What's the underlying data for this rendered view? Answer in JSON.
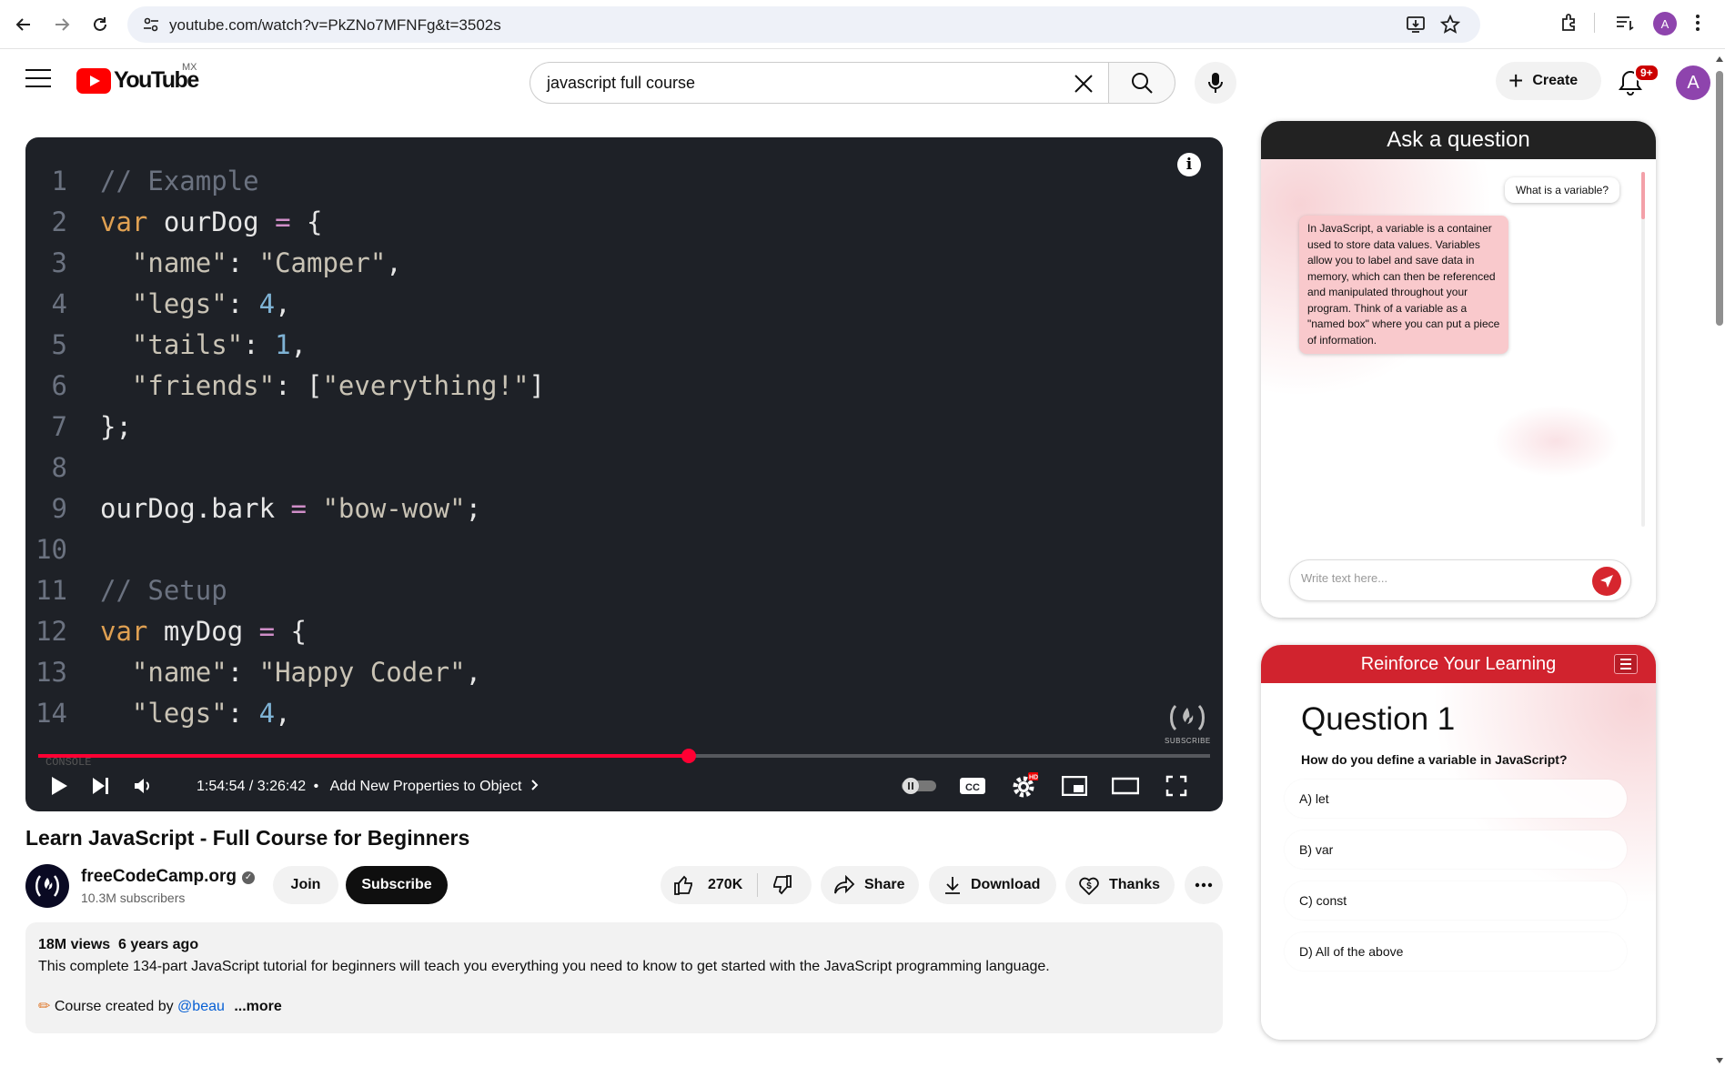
{
  "browser": {
    "url": "youtube.com/watch?v=PkZNo7MFNFg&t=3502s",
    "profile_initial": "A"
  },
  "header": {
    "logo_text": "YouTube",
    "region": "MX",
    "search_value": "javascript full course",
    "create_label": "Create",
    "notification_count": "9+",
    "avatar_initial": "A"
  },
  "player": {
    "code_lines": [
      {
        "n": "1",
        "text": "// Example"
      },
      {
        "n": "2",
        "text": "var ourDog = {"
      },
      {
        "n": "3",
        "text": "  \"name\": \"Camper\","
      },
      {
        "n": "4",
        "text": "  \"legs\": 4,"
      },
      {
        "n": "5",
        "text": "  \"tails\": 1,"
      },
      {
        "n": "6",
        "text": "  \"friends\": [\"everything!\"]"
      },
      {
        "n": "7",
        "text": "};"
      },
      {
        "n": "8",
        "text": ""
      },
      {
        "n": "9",
        "text": "ourDog.bark = \"bow-wow\";"
      },
      {
        "n": "10",
        "text": ""
      },
      {
        "n": "11",
        "text": "// Setup"
      },
      {
        "n": "12",
        "text": "var myDog = {"
      },
      {
        "n": "13",
        "text": "  \"name\": \"Happy Coder\","
      },
      {
        "n": "14",
        "text": "  \"legs\": 4,"
      }
    ],
    "console_label": "CONSOLE",
    "watermark_sub": "SUBSCRIBE",
    "current_time": "1:54:54",
    "duration": "3:26:42",
    "time_display": "1:54:54 / 3:26:42",
    "chapter_sep": "•",
    "chapter": "Add New Properties to Object",
    "progress_fraction": 0.555,
    "settings_badge": "HD"
  },
  "video": {
    "title": "Learn JavaScript - Full Course for Beginners",
    "channel": "freeCodeCamp.org",
    "subscribers": "10.3M subscribers",
    "join_label": "Join",
    "subscribe_label": "Subscribe",
    "likes": "270K",
    "share_label": "Share",
    "download_label": "Download",
    "thanks_label": "Thanks",
    "views": "18M views",
    "age": "6 years ago",
    "description": "This complete 134-part JavaScript tutorial for beginners will teach you everything you need to know to get started with the JavaScript programming language.",
    "credit_prefix": "Course created by",
    "credit_link": "@beau",
    "more_label": "...more"
  },
  "ask_panel": {
    "title": "Ask a question",
    "user_message": "What is a variable?",
    "bot_message": "In JavaScript, a variable is a container used to store data values. Variables allow you to label and save data in memory, which can then be referenced and manipulated throughout your program. Think of a variable as a \"named box\" where you can put a piece of information.",
    "input_placeholder": "Write text here..."
  },
  "quiz_panel": {
    "title": "Reinforce Your Learning",
    "question_title": "Question 1",
    "question_text": "How do you define a variable in JavaScript?",
    "options": [
      "A) let",
      "B) var",
      "C) const",
      "D) All of the above"
    ]
  },
  "colors": {
    "youtube_red": "#ff0000",
    "progress_red": "#ff0033",
    "quiz_red": "#d1232e",
    "player_bg": "#1e2127"
  }
}
